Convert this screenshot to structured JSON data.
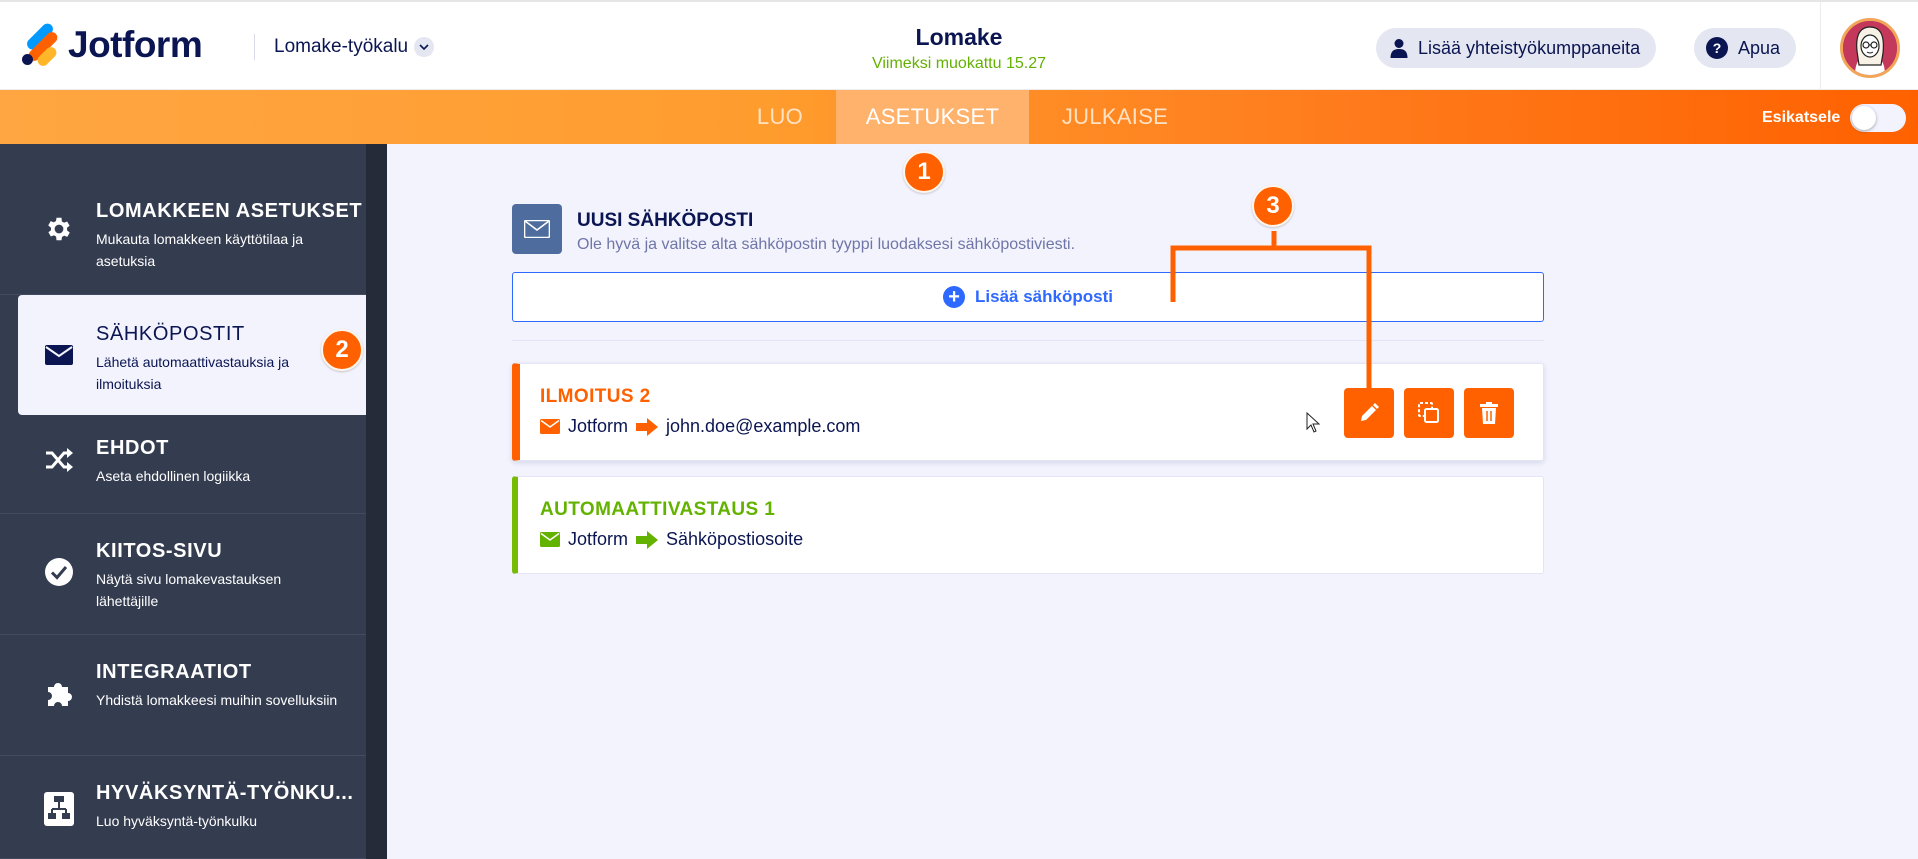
{
  "header": {
    "logo_text": "Jotform",
    "tool_label": "Lomake-työkalu",
    "form_title": "Lomake",
    "form_subtitle": "Viimeksi muokattu 15.27",
    "collab_label": "Lisää yhteistyökumppaneita",
    "help_label": "Apua"
  },
  "nav": {
    "tabs": [
      {
        "label": "LUO"
      },
      {
        "label": "ASETUKSET"
      },
      {
        "label": "JULKAISE"
      }
    ],
    "active_tab": "ASETUKSET",
    "preview_label": "Esikatsele",
    "preview_on": false
  },
  "sidebar": {
    "items": [
      {
        "title": "LOMAKKEEN ASETUKSET",
        "desc": "Mukauta lomakkeen käyttötilaa ja asetuksia",
        "icon": "gear-icon"
      },
      {
        "title": "SÄHKÖPOSTIT",
        "desc": "Lähetä automaattivastauksia ja ilmoituksia",
        "icon": "envelope-icon"
      },
      {
        "title": "EHDOT",
        "desc": "Aseta ehdollinen logiikka",
        "icon": "shuffle-icon"
      },
      {
        "title": "KIITOS-SIVU",
        "desc": "Näytä sivu lomakevastauksen lähettäjille",
        "icon": "check-circle-icon"
      },
      {
        "title": "INTEGRAATIOT",
        "desc": "Yhdistä lomakkeesi muihin sovelluksiin",
        "icon": "puzzle-icon"
      },
      {
        "title": "HYVÄKSYNTÄ-TYÖNKU...",
        "desc": "Luo hyväksyntä-työnkulku",
        "icon": "workflow-icon"
      }
    ],
    "active_index": 1
  },
  "main": {
    "new_email_title": "UUSI SÄHKÖPOSTI",
    "new_email_desc": "Ole hyvä ja valitse alta sähköpostin tyyppi luodaksesi sähköpostiviesti.",
    "add_email_label": "Lisää sähköposti",
    "emails": [
      {
        "title": "ILMOITUS 2",
        "from": "Jotform",
        "to": "john.doe@example.com",
        "color": "#ff6100"
      },
      {
        "title": "AUTOMAATTIVASTAUS 1",
        "from": "Jotform",
        "to": "Sähköpostiosoite",
        "color": "#64b200"
      }
    ]
  },
  "annotations": {
    "step1": "1",
    "step2": "2",
    "step3": "3",
    "color": "#ff6100"
  },
  "colors": {
    "brand_orange": "#ff6100",
    "navy": "#0a1551",
    "blue": "#2e69ff",
    "green": "#64b200",
    "sidebar_bg": "#343c4f"
  }
}
